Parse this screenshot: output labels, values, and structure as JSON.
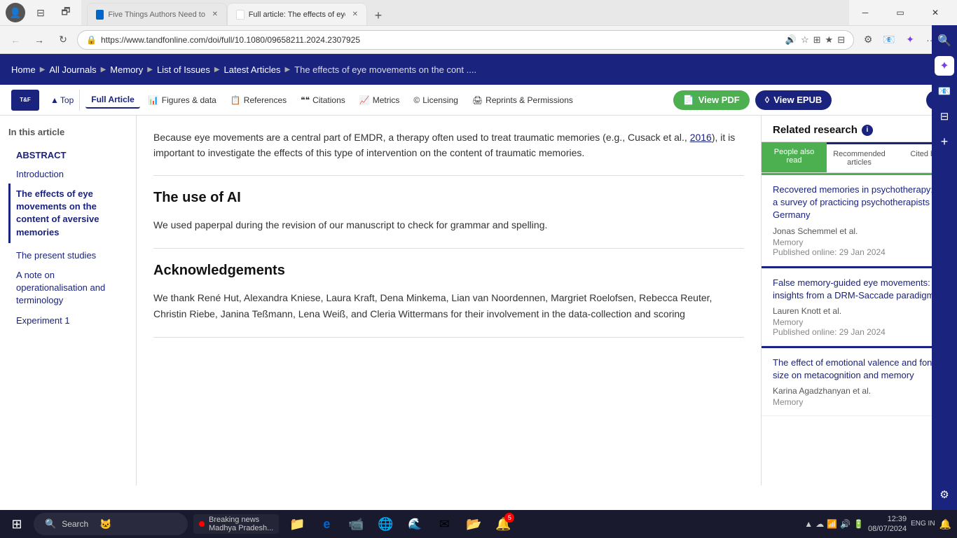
{
  "browser": {
    "tabs": [
      {
        "id": "tab1",
        "label": "Five Things Authors Need to Kno...",
        "favicon": "blue",
        "active": false
      },
      {
        "id": "tab2",
        "label": "Full article: The effects of eye mo...",
        "favicon": "white",
        "active": true
      }
    ],
    "url": "https://www.tandfonline.com/doi/full/10.1080/09658211.2024.2307925",
    "new_tab_label": "+"
  },
  "site_nav": {
    "home": "Home",
    "all_journals": "All Journals",
    "memory": "Memory",
    "list_of_issues": "List of Issues",
    "latest_articles": "Latest Articles",
    "breadcrumb_last": "The effects of eye movements on the cont ...."
  },
  "article_toolbar": {
    "top_link": "Top",
    "full_article": "Full Article",
    "figures_data": "Figures & data",
    "references": "References",
    "citations": "Citations",
    "metrics": "Metrics",
    "licensing": "Licensing",
    "reprints": "Reprints & Permissions",
    "view_pdf": "View PDF",
    "view_epub": "View EPUB"
  },
  "left_sidebar": {
    "in_article_label": "In this article",
    "nav_items": [
      {
        "label": "ABSTRACT",
        "type": "abstract"
      },
      {
        "label": "Introduction",
        "type": "regular"
      },
      {
        "label": "The effects of eye movements on the content of aversive memories",
        "type": "active"
      },
      {
        "label": "The present studies",
        "type": "regular"
      },
      {
        "label": "A note on operationalisation and terminology",
        "type": "regular"
      },
      {
        "label": "Experiment 1",
        "type": "regular"
      }
    ]
  },
  "article_content": {
    "intro_text": "Because eye movements are a central part of EMDR, a therapy often used to treat traumatic memories (e.g., Cusack et al., ",
    "intro_link": "2016",
    "intro_text2": "), it is important to investigate the effects of this type of intervention on the content of traumatic memories.",
    "section1_heading": "The use of AI",
    "section1_para": "We used paperpal during the revision of our manuscript to check for grammar and spelling.",
    "section2_heading": "Acknowledgements",
    "section2_para": "We thank René Hut, Alexandra Kniese, Laura Kraft, Dena Minkema, Lian van Noordennen, Margriet Roelofsen, Rebecca Reuter, Christin Riebe, Janina Teßmann, Lena Weiß, and Cleria Wittermans for their involvement in the data-collection and scoring"
  },
  "related_research": {
    "title": "Related research",
    "tabs": [
      {
        "label": "People also read",
        "id": "people",
        "active": true
      },
      {
        "label": "Recommended articles",
        "id": "recommended",
        "active": false
      },
      {
        "label": "Cited by",
        "id": "cited",
        "active": false
      }
    ],
    "items": [
      {
        "title": "Recovered memories in psychotherapy: a survey of practicing psychotherapists in Germany",
        "author": "Jonas Schemmel et al.",
        "journal": "Memory",
        "date": "Published online: 29 Jan 2024",
        "open_access": true
      },
      {
        "title": "False memory-guided eye movements: insights from a DRM-Saccade paradigm",
        "author": "Lauren Knott et al.",
        "journal": "Memory",
        "date": "Published online: 29 Jan 2024",
        "open_access": true
      },
      {
        "title": "The effect of emotional valence and font size on metacognition and memory",
        "author": "Karina Agadzhanyan et al.",
        "journal": "Memory",
        "date": "",
        "open_access": false
      }
    ]
  },
  "taskbar": {
    "search_placeholder": "Search",
    "time": "12:39",
    "date": "08/07/2024",
    "lang": "ENG\nIN",
    "notification_count": "5",
    "news_label": "Breaking news",
    "news_sub": "Madhya Pradesh..."
  },
  "icons": {
    "back": "←",
    "forward": "→",
    "refresh": "↻",
    "home_nav": "⌂",
    "info": "i",
    "pdf_icon": "📄",
    "epub_icon": "◊",
    "search": "🔍",
    "lock": "🔒",
    "star": "☆",
    "tab_icon": "⊞",
    "read_aloud": "🔊",
    "add": "+",
    "chevron_right": "›",
    "open_access": "🔓",
    "windows": "⊞",
    "gear": "⚙",
    "shield": "🛡",
    "collections": "⊟",
    "favorites": "★",
    "screen_cast": "📺",
    "download": "⬇",
    "settings_edge": "⚙"
  }
}
